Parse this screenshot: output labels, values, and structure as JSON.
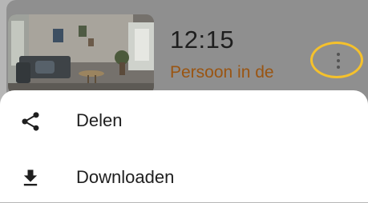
{
  "event": {
    "time": "12:15",
    "label": "Persoon in de",
    "label_color": "#9a5512",
    "more_icon": "more-vert-icon",
    "highlight_color": "#f5c12c"
  },
  "sheet": {
    "items": [
      {
        "label": "Delen",
        "icon": "share-icon"
      },
      {
        "label": "Downloaden",
        "icon": "download-icon"
      }
    ]
  }
}
